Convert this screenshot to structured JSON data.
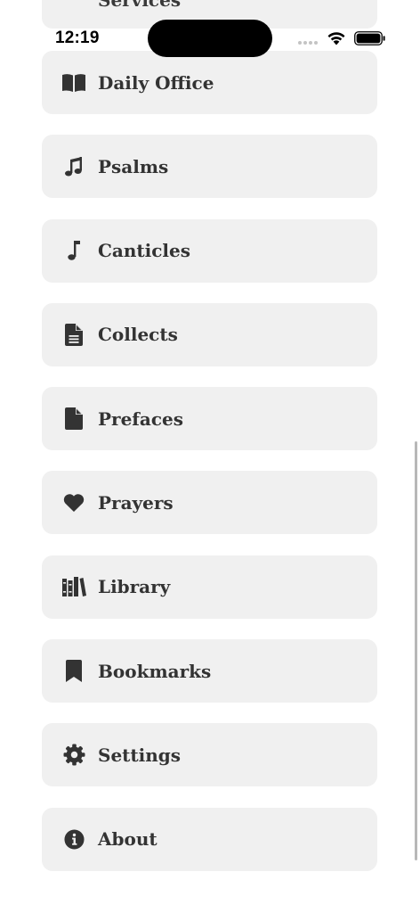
{
  "status": {
    "time": "12:19"
  },
  "partial_item": {
    "label": "Services",
    "icon": "list-icon"
  },
  "menu": {
    "items": [
      {
        "label": "Daily Office",
        "icon": "book-open-icon"
      },
      {
        "label": "Psalms",
        "icon": "music-notes-icon"
      },
      {
        "label": "Canticles",
        "icon": "music-note-icon"
      },
      {
        "label": "Collects",
        "icon": "document-text-icon"
      },
      {
        "label": "Prefaces",
        "icon": "document-icon"
      },
      {
        "label": "Prayers",
        "icon": "heart-icon"
      },
      {
        "label": "Library",
        "icon": "books-icon"
      },
      {
        "label": "Bookmarks",
        "icon": "bookmark-icon"
      },
      {
        "label": "Settings",
        "icon": "gear-icon"
      },
      {
        "label": "About",
        "icon": "info-circle-icon"
      }
    ]
  },
  "colors": {
    "card_background": "#f0f0f0",
    "text": "#333333",
    "icon": "#333333",
    "scrollbar": "#b8b8b8"
  }
}
